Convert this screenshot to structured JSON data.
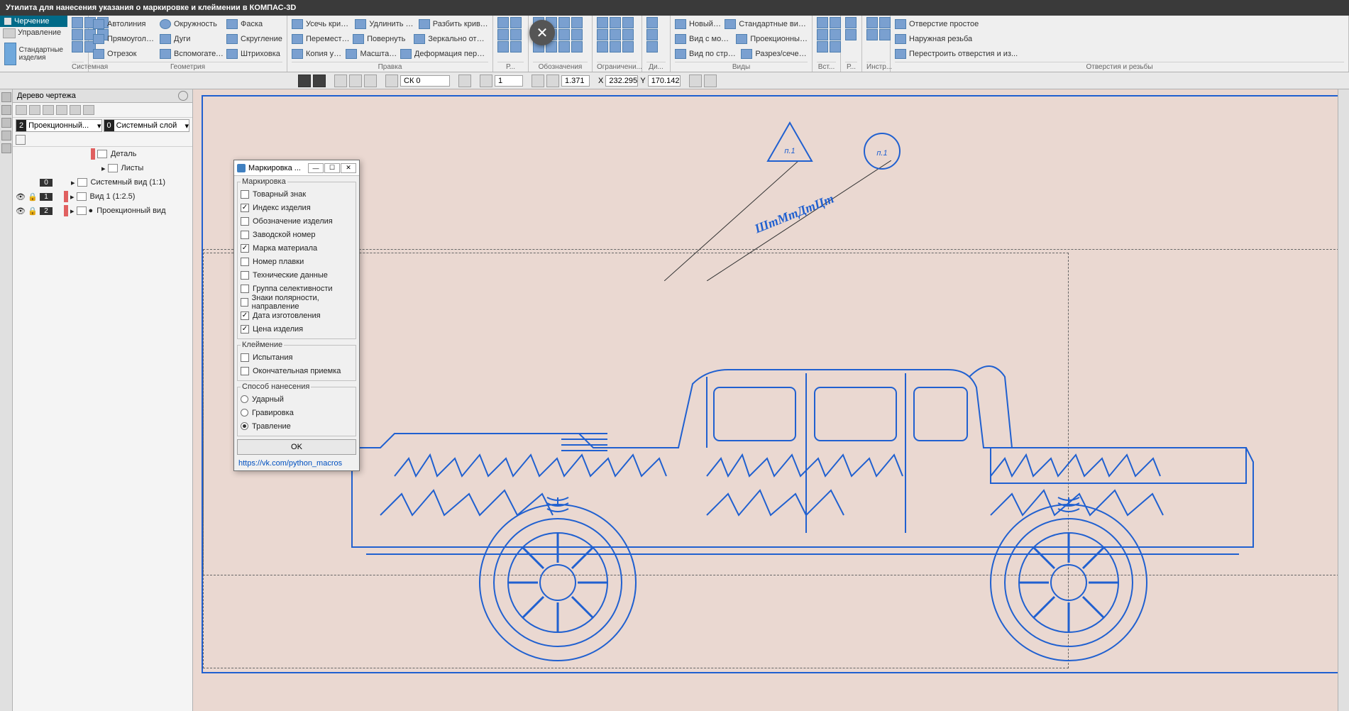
{
  "title": "Утилита для нанесения указания о маркировке и клеймении в КОМПАС-3D",
  "ribbon": {
    "tab": "Черчение",
    "big_tool": "Стандартные изделия",
    "groups": {
      "system": "Системная",
      "geometry": {
        "title": "Геометрия",
        "autoline": "Автолиния",
        "segment": "Отрезок",
        "circle": "Окружность",
        "arc": "Дуги",
        "rect": "Прямоугольник",
        "chamfer": "Фаска",
        "fillet": "Скругление",
        "aux": "Вспомогательн... прямая",
        "hatch": "Штриховка"
      },
      "edit": {
        "title": "Правка",
        "trim": "Усечь кривую",
        "move": "Переместить по координатам",
        "copy": "Копия указанием",
        "extend": "Удлинить до ближайшего о...",
        "rotate": "Повернуть",
        "scale": "Масштабирова...",
        "split": "Разбить кривую...",
        "mirror": "Зеркально отразить",
        "deform": "Деформация перемещением"
      },
      "dims": "Р...",
      "annot": "Обозначения",
      "constr": "Ограничени...",
      "diag": "Ди...",
      "views": {
        "title": "Виды",
        "newview": "Новый вид",
        "frommodel": "Вид с модели...",
        "arrow": "Вид по стрелке",
        "std": "Стандартные виды с модели...",
        "proj": "Проекционный вид",
        "section": "Разрез/сечение"
      },
      "insert": "Вст...",
      "r": "Р...",
      "tools": "Инстр...",
      "holes": {
        "title": "Отверстия и резьбы",
        "simple": "Отверстие простое",
        "thread": "Наружная резьба",
        "rebuild": "Перестроить отверстия и из..."
      }
    }
  },
  "midbar": {
    "cs": "СК 0",
    "step": "1",
    "zoom": "1.371",
    "x": "232.295",
    "y": "170.142",
    "xlabel": "X",
    "ylabel": "Y"
  },
  "sidebar": {
    "title": "Дерево чертежа",
    "sel1_num": "2",
    "sel1": "Проекционный...",
    "sel2_num": "0",
    "sel2": "Системный слой",
    "search_ph": "",
    "items": {
      "detail": "Деталь",
      "sheets": "Листы",
      "sysview": "Системный вид (1:1)",
      "view1": "Вид 1 (1:2.5)",
      "projview": "Проекционный вид"
    },
    "nums": {
      "sys": "0",
      "v1": "1",
      "pv": "2"
    }
  },
  "dialog": {
    "title": "Маркировка ...",
    "group_mark": "Маркировка",
    "marks": {
      "trademark": "Товарный знак",
      "index": "Индекс изделия",
      "designation": "Обозначение изделия",
      "serial": "Заводской номер",
      "material": "Марка материала",
      "melt": "Номер плавки",
      "tech": "Технические данные",
      "select": "Группа селективности",
      "polarity": "Знаки полярности, направление",
      "date": "Дата изготовления",
      "price": "Цена изделия"
    },
    "group_stamp": "Клеймение",
    "stamps": {
      "test": "Испытания",
      "final": "Окончательная приемка"
    },
    "group_method": "Способ нанесения",
    "methods": {
      "impact": "Ударный",
      "engrave": "Гравировка",
      "etch": "Травление"
    },
    "ok": "OK",
    "link": "https://vk.com/python_macros"
  },
  "annotations": {
    "p1": "п.1",
    "text": "ШmMmДmЦm"
  }
}
